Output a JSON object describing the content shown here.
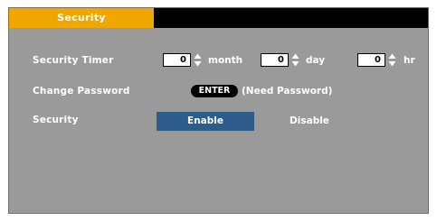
{
  "tab": {
    "title": "Security"
  },
  "rows": {
    "timer": {
      "label": "Security Timer",
      "month": {
        "value": "0",
        "unit": "month"
      },
      "day": {
        "value": "0",
        "unit": "day"
      },
      "hr": {
        "value": "0",
        "unit": "hr"
      }
    },
    "password": {
      "label": "Change Password",
      "key": "ENTER",
      "note": "(Need Password)"
    },
    "security": {
      "label": "Security",
      "enable": "Enable",
      "disable": "Disable",
      "selected": "Enable"
    }
  },
  "colors": {
    "panel": "#9a9a9a",
    "tab_active": "#f0a800",
    "tabbar": "#000000",
    "selected_option": "#2e5c8a"
  }
}
